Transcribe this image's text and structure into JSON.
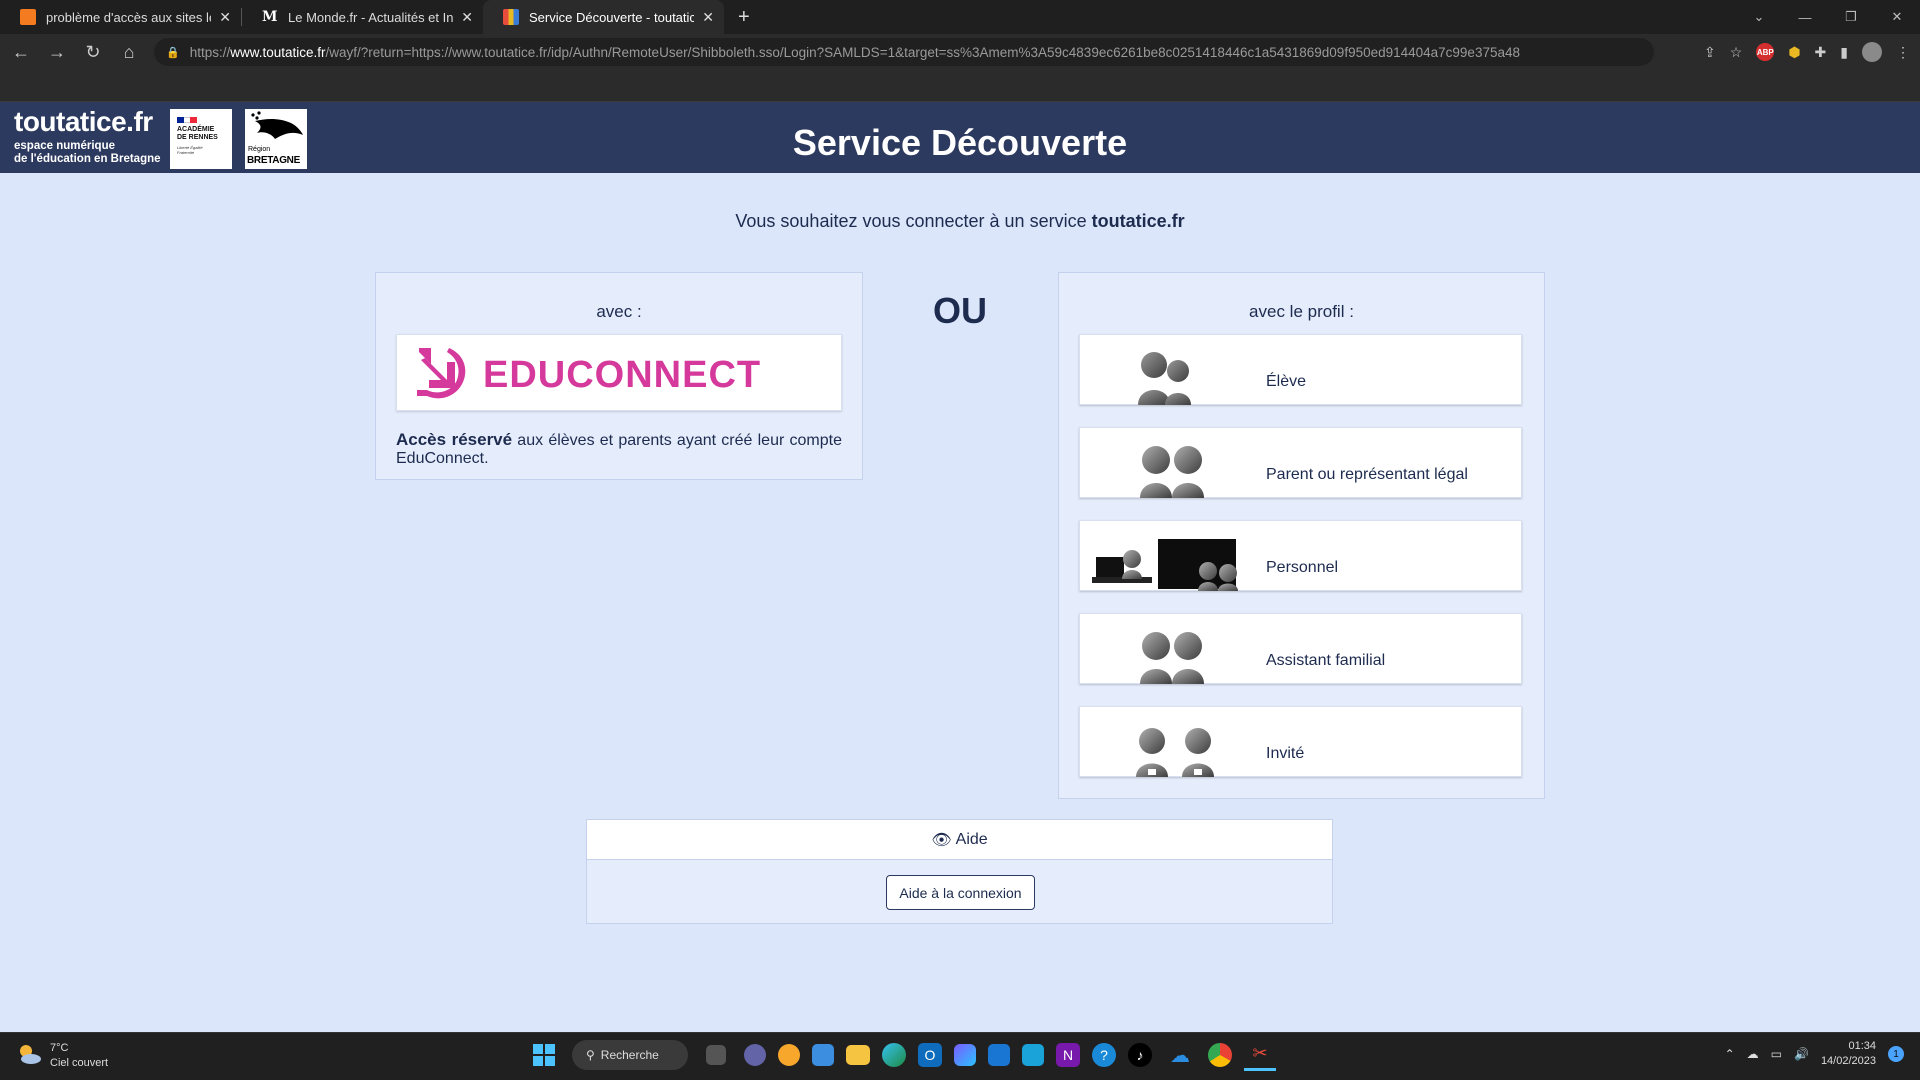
{
  "browser": {
    "tabs": [
      {
        "title": "problème d'accès aux sites lemonde",
        "favicon_color": "#f47b20",
        "active": false
      },
      {
        "title": "Le Monde.fr - Actualités et Infos",
        "favicon_color": "#ffffff",
        "active": false
      },
      {
        "title": "Service Découverte - toutatice.fr",
        "favicon_color": "#e8b923",
        "active": true
      }
    ],
    "url_scheme": "https://",
    "url_host": "www.toutatice.fr",
    "url_rest": "/wayf/?return=https://www.toutatice.fr/idp/Authn/RemoteUser/Shibboleth.sso/Login?SAMLDS=1&target=ss%3Amem%3A59c4839ec6261be8c0251418446c1a5431869d09f950ed914404a7c99e375a48",
    "ext_abp": "ABP"
  },
  "header": {
    "brand_name": "toutatice.fr",
    "brand_sub1": "espace numérique",
    "brand_sub2": "de l'éducation en Bretagne",
    "academie_line1": "ACADÉMIE",
    "academie_line2": "DE RENNES",
    "academie_motto": "Liberté Égalité Fraternité",
    "region_small": "Région",
    "region_big": "BRETAGNE",
    "title": "Service Découverte"
  },
  "main": {
    "intro_text": "Vous souhaitez vous connecter à un service ",
    "intro_bold": "toutatice.fr",
    "left_heading": "avec :",
    "educonnect_label": "EDUCONNECT",
    "note_bold": "Accès réservé",
    "note_text": " aux élèves et parents ayant créé leur compte EduConnect.",
    "ou": "OU",
    "right_heading": "avec le profil :",
    "profiles": [
      {
        "label": "Élève"
      },
      {
        "label": "Parent ou représentant légal"
      },
      {
        "label": "Personnel"
      },
      {
        "label": "Assistant familial"
      },
      {
        "label": "Invité"
      }
    ],
    "help_title": "Aide",
    "help_button": "Aide à la connexion"
  },
  "taskbar": {
    "temperature": "7°C",
    "weather": "Ciel couvert",
    "search_label": "Recherche",
    "time": "01:34",
    "date": "14/02/2023",
    "notifications": "1"
  },
  "colors": {
    "header_bg": "#2d3a5f",
    "page_bg": "#dbe6fb",
    "educonnect": "#d4399b"
  }
}
